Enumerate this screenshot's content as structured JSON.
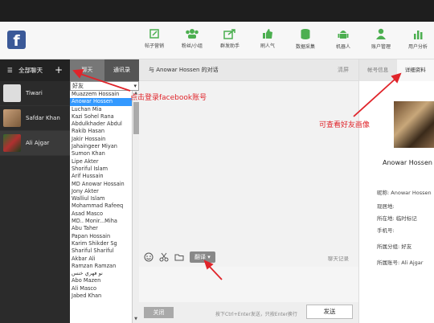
{
  "toolbar": {
    "tools": [
      {
        "label": "帖子营销",
        "icon": "edit-icon"
      },
      {
        "label": "粉丝/小组",
        "icon": "users-icon"
      },
      {
        "label": "群发助手",
        "icon": "share-icon"
      },
      {
        "label": "刷人气",
        "icon": "thumbs-up-icon"
      },
      {
        "label": "数据采集",
        "icon": "database-icon"
      },
      {
        "label": "机器人",
        "icon": "android-icon"
      },
      {
        "label": "账户管理",
        "icon": "user-icon"
      },
      {
        "label": "用户分析",
        "icon": "chart-icon"
      }
    ]
  },
  "sidebar": {
    "title": "全部聊天",
    "plus": "+",
    "chats": [
      {
        "name": "Tiwari"
      },
      {
        "name": "Safdar Khan"
      },
      {
        "name": "Ali Ajgar"
      }
    ]
  },
  "middle": {
    "tabs": [
      "聊天",
      "通讯录"
    ],
    "filter": "好友",
    "friends": [
      "Muazzem Hossain",
      "Anowar Hossen",
      "Luchan Mia",
      "Kazi Sohel Rana",
      "Abdulkhader Abdul",
      "Rakib Hasan",
      "Jakir Hossain",
      "Jahaingeer Miyan",
      "Sumon Khan",
      "Lipe Akter",
      "Shoriful Islam",
      "Arif Hussain",
      "MD Anowar Hossain",
      "Jony Akter",
      "Walliul Islam",
      "Mohammad Rafeeq",
      "Asad Masco",
      "MD.. Monir...Miha",
      "Abu Taher",
      "Papan Hossain",
      "Karim Shikder Sg",
      "Shariful Shariful",
      "Akbar Ali",
      "Ramzan Ramzan",
      "نو فهري خنس",
      "Abo Mazen",
      "Ali Masco",
      "Jabed Khan"
    ],
    "selected_index": 1
  },
  "chat": {
    "title": "与 Anowar Hossen 的对话",
    "clear": "清屏",
    "translate": "翻译 ▾",
    "log": "聊天记录",
    "close": "关闭",
    "hint": "按下Ctrl+Enter发送，只按Enter换行",
    "send": "发送"
  },
  "profile": {
    "tabs": [
      "帐号信息",
      "详细资料"
    ],
    "name": "Anowar Hossen",
    "rows": [
      {
        "label": "昵称:",
        "value": "Anowar Hossen"
      },
      {
        "label": "现居地:",
        "value": ""
      },
      {
        "label": "所在地:",
        "value": "临时标记"
      },
      {
        "label": "手机号:",
        "value": ""
      },
      {
        "label": "所属分组:",
        "value": "好友"
      },
      {
        "label": "所属账号:",
        "value": "Ali Ajgar"
      }
    ]
  },
  "annotations": {
    "login": "点击登录facebook账号",
    "avatar": "可查看好友画像"
  },
  "colors": {
    "accent": "#3b5998",
    "tool_icon": "#4caf50",
    "selected": "#3399ff",
    "annotation": "#e0242a"
  }
}
